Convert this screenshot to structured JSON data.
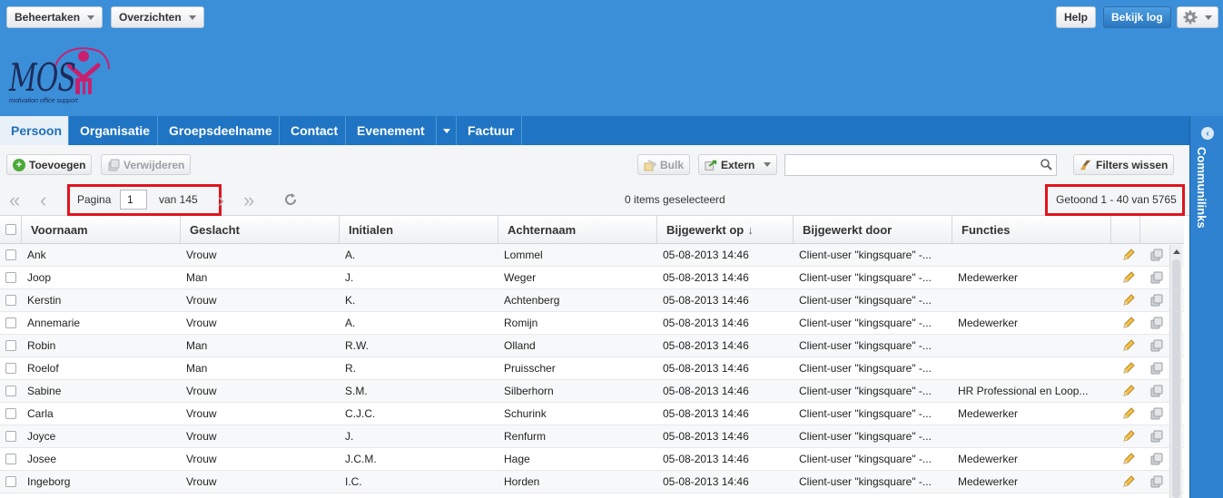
{
  "topbar": {
    "menu_beheertaken": "Beheertaken",
    "menu_overzichten": "Overzichten",
    "help": "Help",
    "bekijk_log": "Bekijk log"
  },
  "logo": {
    "text": "MOS",
    "sub": "motivation office support"
  },
  "tabs": [
    "Persoon",
    "Organisatie",
    "Groepsdeelname",
    "Contact",
    "Evenement",
    "Factuur"
  ],
  "side": {
    "label": "Communilinks"
  },
  "toolbar": {
    "add": "Toevoegen",
    "delete": "Verwijderen",
    "bulk": "Bulk",
    "extern": "Extern",
    "clear_filters": "Filters wissen",
    "search_value": ""
  },
  "pager": {
    "page_label": "Pagina",
    "page": "1",
    "of_label": "van 145",
    "selected": "0 items geselecteerd",
    "shown": "Getoond 1 - 40 van 5765"
  },
  "grid": {
    "columns": [
      "Voornaam",
      "Geslacht",
      "Initialen",
      "Achternaam",
      "Bijgewerkt op",
      "Bijgewerkt door",
      "Functies"
    ],
    "sort_column": "Bijgewerkt op",
    "sort_dir": "desc",
    "rows": [
      [
        "Ank",
        "Vrouw",
        "A.",
        "Lommel",
        "05-08-2013 14:46",
        "Client-user \"kingsquare\" -...",
        ""
      ],
      [
        "Joop",
        "Man",
        "J.",
        "Weger",
        "05-08-2013 14:46",
        "Client-user \"kingsquare\" -...",
        "Medewerker"
      ],
      [
        "Kerstin",
        "Vrouw",
        "K.",
        "Achtenberg",
        "05-08-2013 14:46",
        "Client-user \"kingsquare\" -...",
        ""
      ],
      [
        "Annemarie",
        "Vrouw",
        "A.",
        "Romijn",
        "05-08-2013 14:46",
        "Client-user \"kingsquare\" -...",
        "Medewerker"
      ],
      [
        "Robin",
        "Man",
        "R.W.",
        "Olland",
        "05-08-2013 14:46",
        "Client-user \"kingsquare\" -...",
        ""
      ],
      [
        "Roelof",
        "Man",
        "R.",
        "Pruisscher",
        "05-08-2013 14:46",
        "Client-user \"kingsquare\" -...",
        ""
      ],
      [
        "Sabine",
        "Vrouw",
        "S.M.",
        "Silberhorn",
        "05-08-2013 14:46",
        "Client-user \"kingsquare\" -...",
        "HR Professional en Loop..."
      ],
      [
        "Carla",
        "Vrouw",
        "C.J.C.",
        "Schurink",
        "05-08-2013 14:46",
        "Client-user \"kingsquare\" -...",
        "Medewerker"
      ],
      [
        "Joyce",
        "Vrouw",
        "J.",
        "Renfurm",
        "05-08-2013 14:46",
        "Client-user \"kingsquare\" -...",
        ""
      ],
      [
        "Josee",
        "Vrouw",
        "J.C.M.",
        "Hage",
        "05-08-2013 14:46",
        "Client-user \"kingsquare\" -...",
        "Medewerker"
      ],
      [
        "Ingeborg",
        "Vrouw",
        "I.C.",
        "Horden",
        "05-08-2013 14:46",
        "Client-user \"kingsquare\" -...",
        "Medewerker"
      ]
    ]
  },
  "colors": {
    "header_blue": "#3b8fd8",
    "tab_blue": "#1f74c3",
    "highlight_red": "#e0141e",
    "logo_pink": "#c8206e"
  },
  "icons": [
    "settings-gear-icon",
    "add-icon",
    "delete-icon",
    "bulk-icon",
    "extern-icon",
    "search-icon",
    "clear-filters-icon",
    "edit-pencil-icon",
    "delete-row-icon",
    "refresh-icon"
  ]
}
